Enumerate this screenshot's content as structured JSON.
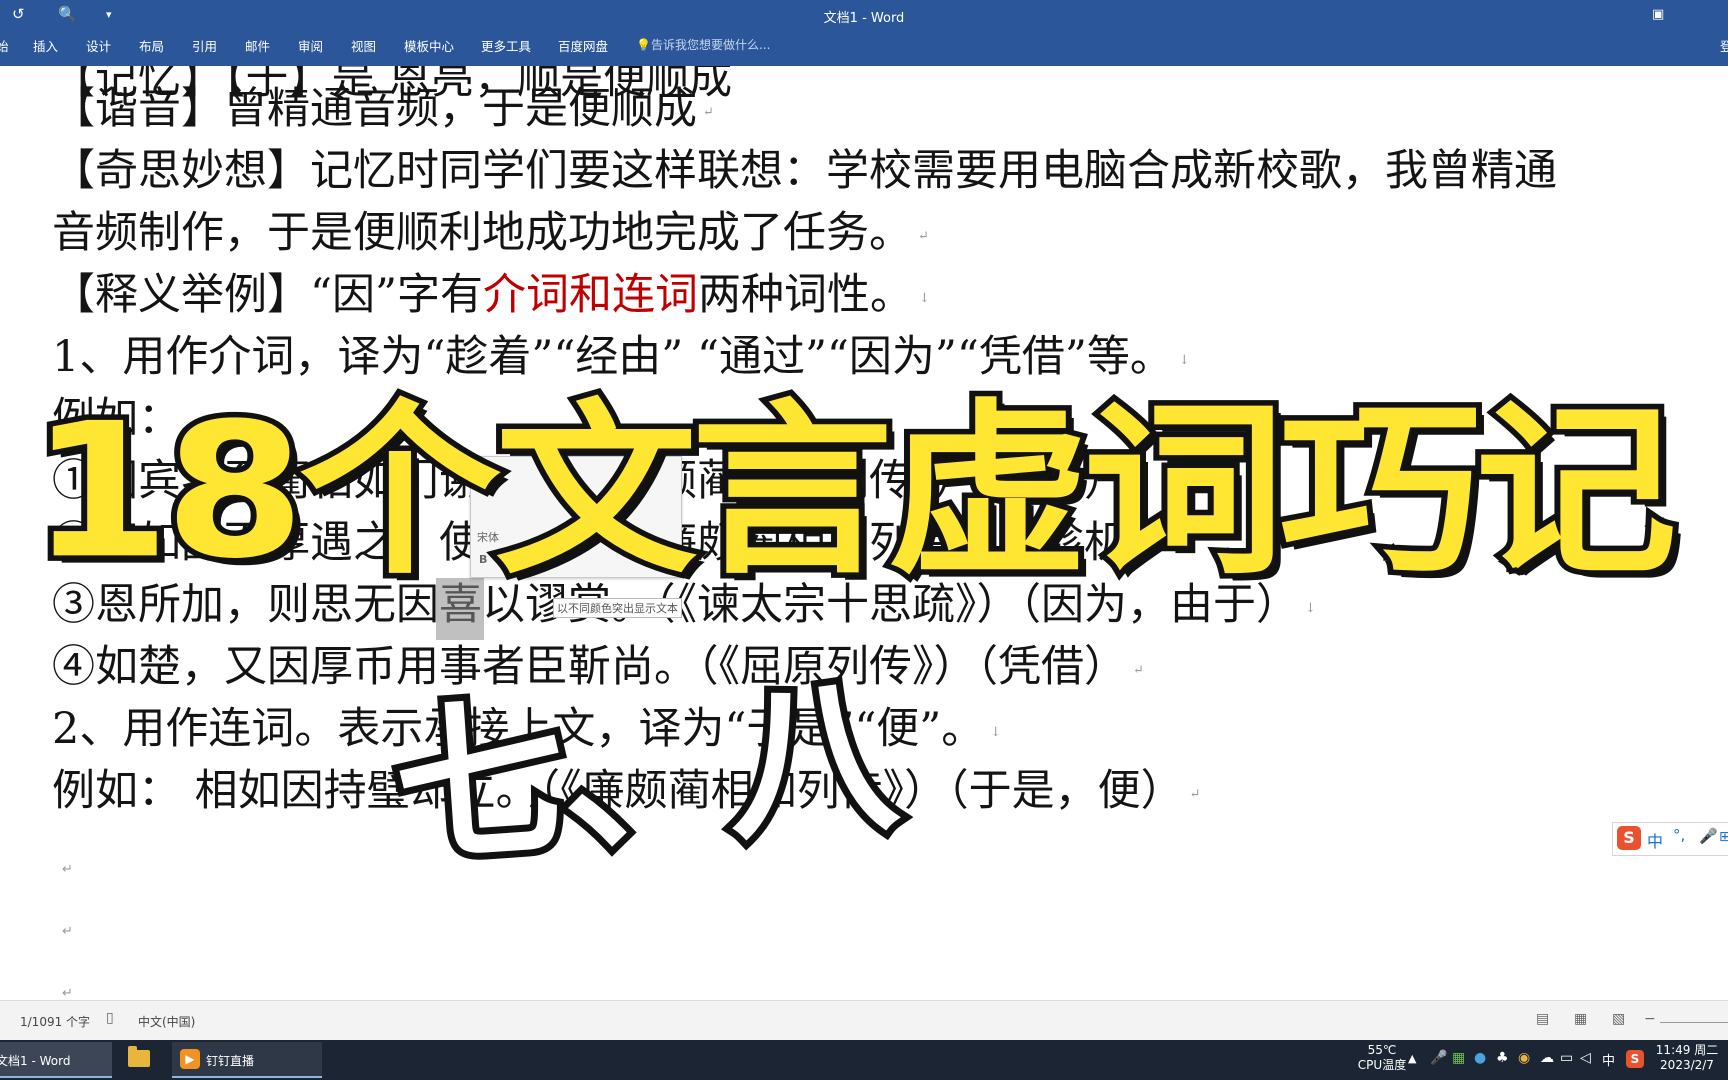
{
  "window": {
    "title": "文档1 - Word",
    "qat_icons": [
      "undo-icon",
      "print-preview-icon",
      "customize-qat-icon"
    ]
  },
  "ribbon": {
    "tabs": [
      "插入",
      "设计",
      "布局",
      "引用",
      "邮件",
      "审阅",
      "视图",
      "模板中心",
      "更多工具",
      "百度网盘"
    ],
    "tell_me": "告诉我您想要做什么...",
    "right_text": "登"
  },
  "document": {
    "lines": [
      {
        "pre": "【谐音】曾精通音频，于是便顺成"
      },
      {
        "pre": "【奇思妙想】记忆时同学们要这样联想：学校需要用电脑合成新校歌，我曾精通"
      },
      {
        "pre": "音频制作，于是便顺利地成功地完成了任务。"
      },
      {
        "pre": "【释义举例】“因”字有",
        "red": "介词和连词",
        "post": "两种词性。"
      },
      {
        "pre": "1、用作介词，译为“趁着”“经由” “通过”“因为”“凭借”等。"
      },
      {
        "pre": "例如："
      },
      {
        "pre": "①因宾客至蔺相如门谢罪。（《廉颇蔺相如列传》）（经由）"
      },
      {
        "pre": "②不如因而厚遇之，使归赵。（《廉颇蔺相如列传》）（趁机）"
      },
      {
        "pre": "③恩所加，则思无因喜以谬赏。（《谏太宗十思疏》）（因为，由于）"
      },
      {
        "pre": "④如楚，又因厚币用事者臣靳尚。（《屈原列传》）（凭借）"
      },
      {
        "pre": "2、用作连词。表示承接上文，译为“于是”“便”。"
      },
      {
        "pre": "例如：  相如因持璧却立。（《廉颇蔺相如列传》）（于是，便）"
      }
    ],
    "mini_toolbar": {
      "font": "宋体",
      "wen": "wén 文",
      "bold": "B",
      "size": "三"
    },
    "tooltip": "以不同颜色突出显示文本"
  },
  "overlay": {
    "title": "18个文言虚词巧记",
    "subtitle": "七、八"
  },
  "ime": {
    "logo": "S",
    "mode": "中",
    "punct": "°,",
    "mic_icon": "microphone-icon"
  },
  "status_bar": {
    "page": "1/1091 个字",
    "language": "中文(中国)"
  },
  "taskbar": {
    "word_label": "文档1 - Word",
    "dingtalk_label": "钉钉直播",
    "temp": "55℃",
    "temp_label": "CPU温度",
    "ime": "中",
    "time": "11:49 周二",
    "date": "2023/2/7"
  },
  "colors": {
    "ribbon": "#2b579a",
    "taskbar": "#1c2533",
    "title_yellow": "#ffe633",
    "red_text": "#c00000"
  }
}
